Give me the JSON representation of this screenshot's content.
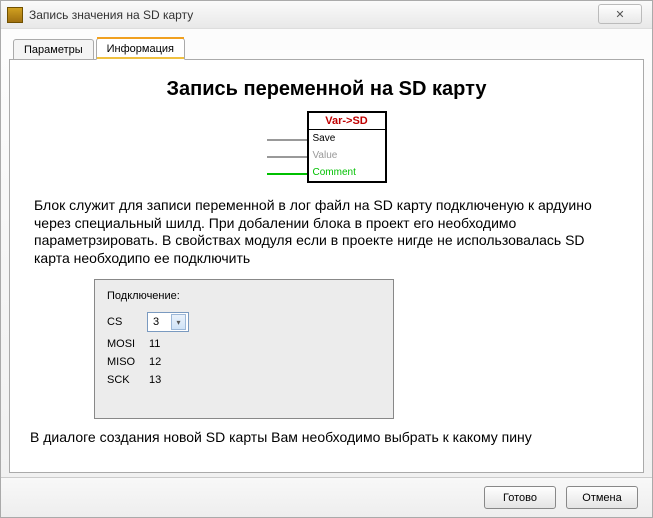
{
  "window": {
    "title": "Запись значения на SD карту",
    "close_glyph": "✕"
  },
  "tabs": {
    "params": "Параметры",
    "info": "Информация"
  },
  "content": {
    "heading": "Запись переменной на SD карту",
    "block": {
      "header": "Var->SD",
      "save": "Save",
      "value": "Value",
      "comment": "Comment"
    },
    "description": "Блок служит для записи переменной в лог файл на SD карту подключеную к ардуино через специальный шилд. При добалении блока в проект его необходимо параметрзировать. В свойствах модуля если в проекте нигде не использовалась SD карта необходипо ее подключить",
    "connection": {
      "title": "Подключение:",
      "rows": {
        "cs_label": "CS",
        "cs_value": "3",
        "mosi_label": "MOSI",
        "mosi_value": "11",
        "miso_label": "MISO",
        "miso_value": "12",
        "sck_label": "SCK",
        "sck_value": "13"
      }
    },
    "description2": "В диалоге создания новой SD карты Вам необходимо выбрать к какому пину"
  },
  "footer": {
    "ok": "Готово",
    "cancel": "Отмена"
  }
}
